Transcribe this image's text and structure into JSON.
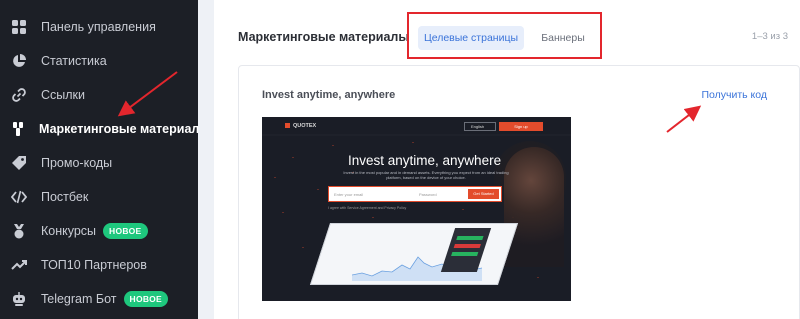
{
  "sidebar": {
    "items": [
      {
        "label": "Панель управления",
        "icon": "dashboard-icon"
      },
      {
        "label": "Статистика",
        "icon": "pie-chart-icon"
      },
      {
        "label": "Ссылки",
        "icon": "link-icon"
      },
      {
        "label": "Маркетинговые материалы",
        "icon": "brush-icon",
        "active": true
      },
      {
        "label": "Промо-коды",
        "icon": "tag-icon"
      },
      {
        "label": "Постбек",
        "icon": "code-icon"
      },
      {
        "label": "Конкурсы",
        "icon": "medal-icon",
        "badge": "НОВОЕ"
      },
      {
        "label": "ТОП10 Партнеров",
        "icon": "trend-icon"
      },
      {
        "label": "Telegram Бот",
        "icon": "robot-icon",
        "badge": "НОВОЕ"
      }
    ]
  },
  "main": {
    "title": "Маркетинговые материалы",
    "tabs": [
      {
        "label": "Целевые страницы",
        "active": true
      },
      {
        "label": "Баннеры",
        "active": false
      }
    ],
    "pager": "1–3 из 3",
    "card": {
      "title": "Invest anytime, anywhere",
      "get_code": "Получить код"
    },
    "banner": {
      "logo": "QUOTEX",
      "lang": "English",
      "signup": "Sign up",
      "headline": "Invest anytime, anywhere",
      "subtitle": "Invest in the most popular and in demand assets. Everything you expect from an ideal trading platform, based on the device of your choice.",
      "email_placeholder": "Enter your email",
      "password_placeholder": "Password",
      "start_button": "Get Started",
      "agree": "I agree with Service Agreement and Privacy Policy"
    }
  },
  "colors": {
    "sidebar_bg": "#1c1f26",
    "accent_blue": "#3a73d9",
    "badge_green": "#1ec77d",
    "annotation_red": "#e3262d",
    "banner_orange": "#e34c2c"
  }
}
